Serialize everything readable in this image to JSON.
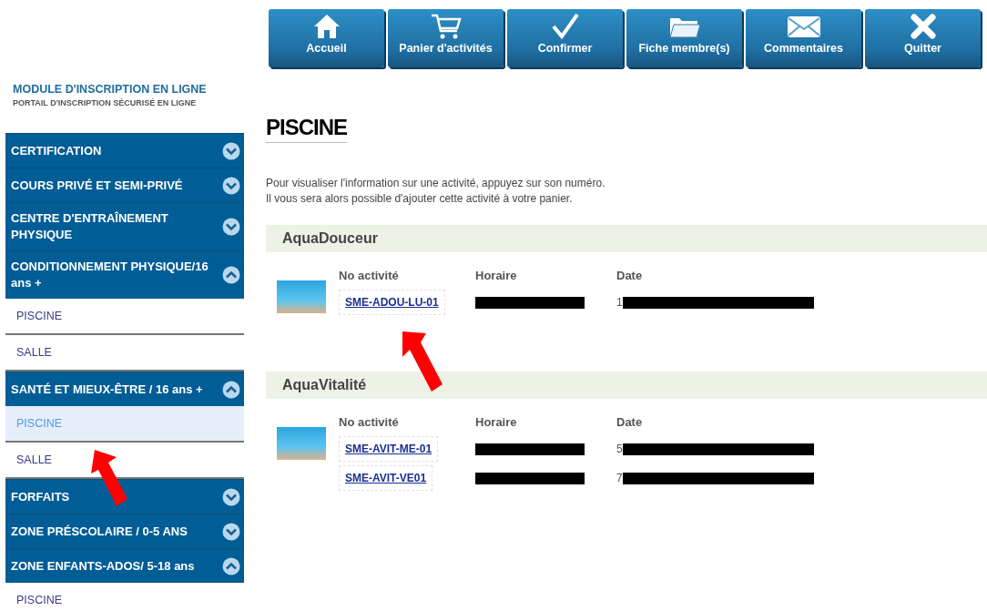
{
  "toolbar": [
    {
      "label": "Accueil"
    },
    {
      "label": "Panier d'activités"
    },
    {
      "label": "Confirmer"
    },
    {
      "label": "Fiche membre(s)"
    },
    {
      "label": "Commentaires"
    },
    {
      "label": "Quitter"
    }
  ],
  "brand": {
    "title": "MODULE D'INSCRIPTION EN LIGNE",
    "subtitle": "PORTAIL D'INSCRIPTION SÉCURISÉ EN LIGNE"
  },
  "sidebar": {
    "items": [
      {
        "label": "CERTIFICATION",
        "expanded": false
      },
      {
        "label": "COURS PRIVÉ ET SEMI-PRIVÉ",
        "expanded": false
      },
      {
        "label": "CENTRE D'ENTRAÎNEMENT PHYSIQUE",
        "expanded": false
      },
      {
        "label": "CONDITIONNEMENT PHYSIQUE/16 ans +",
        "expanded": true,
        "children": [
          {
            "label": "PISCINE",
            "selected": false
          },
          {
            "label": "SALLE",
            "selected": false
          }
        ]
      },
      {
        "label": "SANTÉ ET MIEUX-ÊTRE / 16 ans +",
        "expanded": true,
        "children": [
          {
            "label": "PISCINE",
            "selected": true
          },
          {
            "label": "SALLE",
            "selected": false
          }
        ]
      },
      {
        "label": "FORFAITS",
        "expanded": false
      },
      {
        "label": "ZONE PRÉSCOLAIRE / 0-5 ANS",
        "expanded": false
      },
      {
        "label": "ZONE ENFANTS-ADOS/ 5-18 ans",
        "expanded": true,
        "children": [
          {
            "label": "PISCINE",
            "selected": false
          }
        ]
      }
    ]
  },
  "page": {
    "title": "PISCINE",
    "intro": [
      "Pour visualiser l'information sur une activité, appuyez sur son numéro.",
      "Il vous sera alors possible d'ajouter cette activité à votre panier."
    ]
  },
  "sections": [
    {
      "title": "AquaDouceur",
      "columns": [
        "No activité",
        "Horaire",
        "Date"
      ],
      "rows": [
        {
          "number": "SME-ADOU-LU-01",
          "date_start": "1"
        }
      ]
    },
    {
      "title": "AquaVitalité",
      "columns": [
        "No activité",
        "Horaire",
        "Date"
      ],
      "rows": [
        {
          "number": "SME-AVIT-ME-01",
          "date_start": "5"
        },
        {
          "number": "SME-AVIT-VE01",
          "date_start": "7"
        }
      ]
    }
  ]
}
